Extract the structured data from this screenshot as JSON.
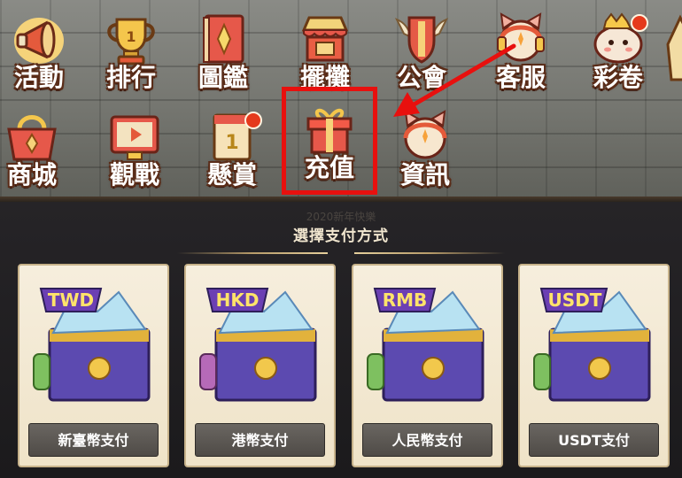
{
  "menu": {
    "row1": [
      {
        "label": "活動",
        "icon": "megaphone-icon"
      },
      {
        "label": "排行",
        "icon": "trophy-icon"
      },
      {
        "label": "圖鑑",
        "icon": "book-icon"
      },
      {
        "label": "擺攤",
        "icon": "stall-icon"
      },
      {
        "label": "公會",
        "icon": "guild-shield-icon"
      },
      {
        "label": "客服",
        "icon": "headset-cat-icon"
      },
      {
        "label": "彩卷",
        "icon": "lottery-mascot-icon"
      }
    ],
    "row2": [
      {
        "label": "商城",
        "icon": "shop-basket-icon"
      },
      {
        "label": "觀戰",
        "icon": "spectate-screen-icon"
      },
      {
        "label": "懸賞",
        "icon": "bounty-icon"
      },
      {
        "label": "充值",
        "icon": "gift-box-icon"
      },
      {
        "label": "資訊",
        "icon": "info-cat-icon"
      }
    ]
  },
  "payment": {
    "title": "選擇支付方式",
    "background_text": "2020新年快樂",
    "options": [
      {
        "currency": "TWD",
        "button": "新臺幣支付"
      },
      {
        "currency": "HKD",
        "button": "港幣支付"
      },
      {
        "currency": "RMB",
        "button": "人民幣支付"
      },
      {
        "currency": "USDT",
        "button": "USDT支付"
      }
    ]
  },
  "colors": {
    "highlight": "#e8100e",
    "label_outline": "#5a2c18",
    "card_bg": "#f6eedd",
    "button_bg": "#5c5854",
    "tag_purple": "#6b3fb3",
    "tag_text": "#ffe36a"
  }
}
